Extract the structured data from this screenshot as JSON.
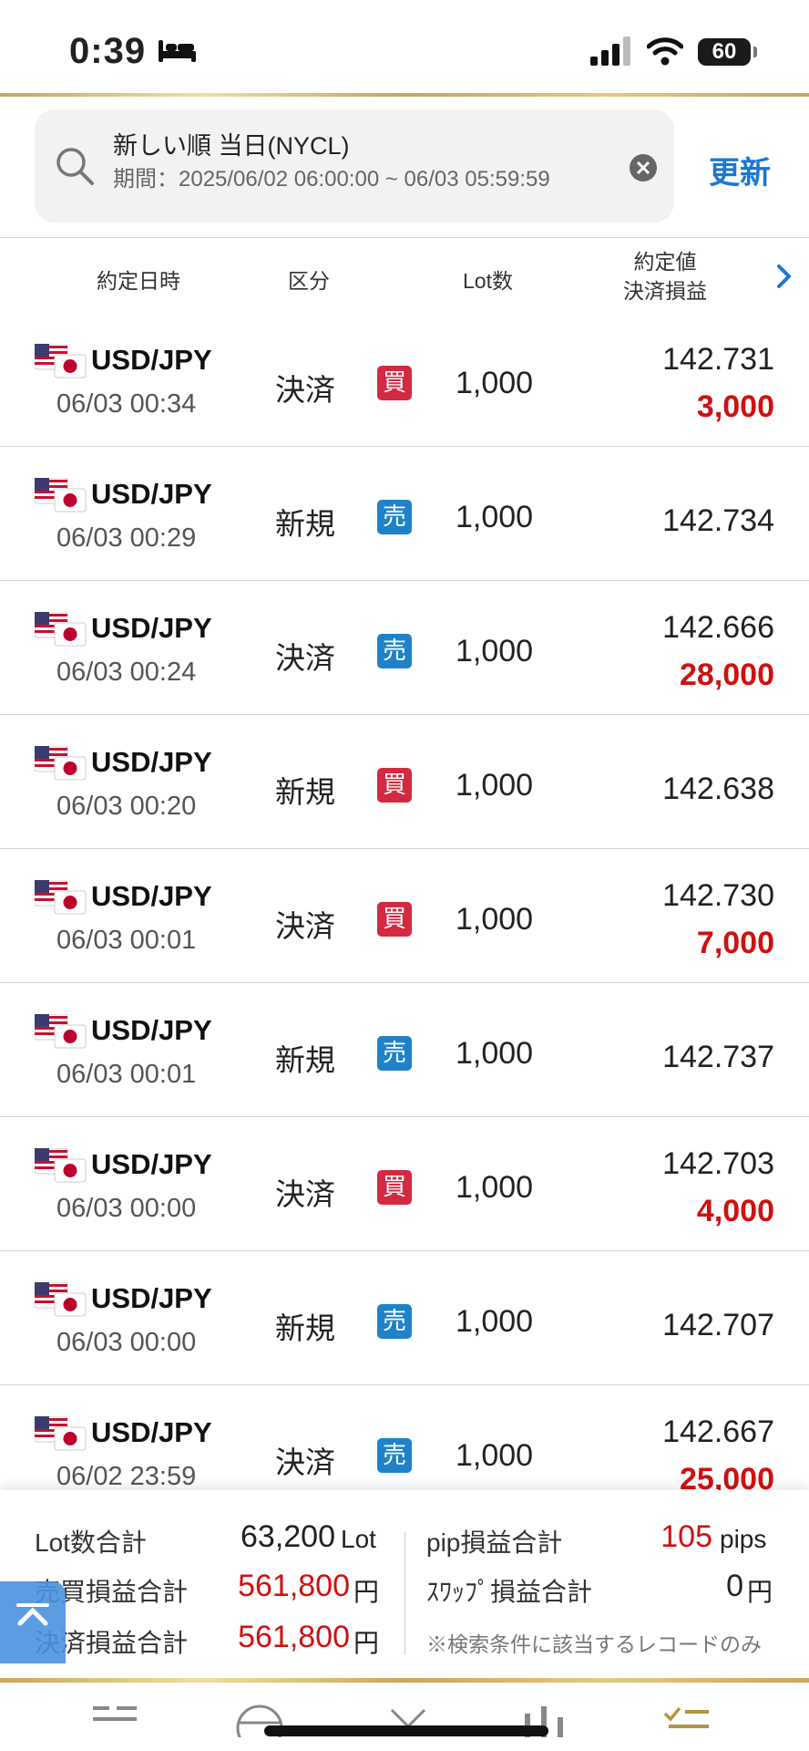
{
  "status": {
    "time": "0:39",
    "battery": "60"
  },
  "search": {
    "title": "新しい順 当日(NYCL)",
    "period": "期間：2025/06/02 06:00:00 ~ 06/03 05:59:59",
    "refresh_label": "更新"
  },
  "headers": {
    "date": "約定日時",
    "kubun": "区分",
    "lot": "Lot数",
    "price_line1": "約定値",
    "price_line2": "決済損益"
  },
  "rows": [
    {
      "pair": "USD/JPY",
      "time": "06/03 00:34",
      "kind": "決済",
      "side": "買",
      "lot": "1,000",
      "price": "142.731",
      "pl": "3,000"
    },
    {
      "pair": "USD/JPY",
      "time": "06/03 00:29",
      "kind": "新規",
      "side": "売",
      "lot": "1,000",
      "price": "142.734",
      "pl": ""
    },
    {
      "pair": "USD/JPY",
      "time": "06/03 00:24",
      "kind": "決済",
      "side": "売",
      "lot": "1,000",
      "price": "142.666",
      "pl": "28,000"
    },
    {
      "pair": "USD/JPY",
      "time": "06/03 00:20",
      "kind": "新規",
      "side": "買",
      "lot": "1,000",
      "price": "142.638",
      "pl": ""
    },
    {
      "pair": "USD/JPY",
      "time": "06/03 00:01",
      "kind": "決済",
      "side": "買",
      "lot": "1,000",
      "price": "142.730",
      "pl": "7,000"
    },
    {
      "pair": "USD/JPY",
      "time": "06/03 00:01",
      "kind": "新規",
      "side": "売",
      "lot": "1,000",
      "price": "142.737",
      "pl": ""
    },
    {
      "pair": "USD/JPY",
      "time": "06/03 00:00",
      "kind": "決済",
      "side": "買",
      "lot": "1,000",
      "price": "142.703",
      "pl": "4,000"
    },
    {
      "pair": "USD/JPY",
      "time": "06/03 00:00",
      "kind": "新規",
      "side": "売",
      "lot": "1,000",
      "price": "142.707",
      "pl": ""
    },
    {
      "pair": "USD/JPY",
      "time": "06/02 23:59",
      "kind": "決済",
      "side": "売",
      "lot": "1,000",
      "price": "142.667",
      "pl": "25,000"
    }
  ],
  "summary": {
    "lot_total_label": "Lot数合計",
    "lot_total_value": "63,200",
    "lot_total_unit": "Lot",
    "trade_pl_label": "売買損益合計",
    "trade_pl_value": "561,800",
    "trade_pl_unit": "円",
    "settle_pl_label": "決済損益合計",
    "settle_pl_value": "561,800",
    "settle_pl_unit": "円",
    "pip_label": "pip損益合計",
    "pip_value": "105",
    "pip_unit": "pips",
    "swap_label": "ｽﾜｯﾌﾟ損益合計",
    "swap_value": "0",
    "swap_unit": "円",
    "note": "※検索条件に該当するレコードのみ"
  },
  "colors": {
    "buy": "#d32a42",
    "sell": "#1f82c8",
    "profit": "#d01010",
    "accent": "#1a78d2"
  }
}
